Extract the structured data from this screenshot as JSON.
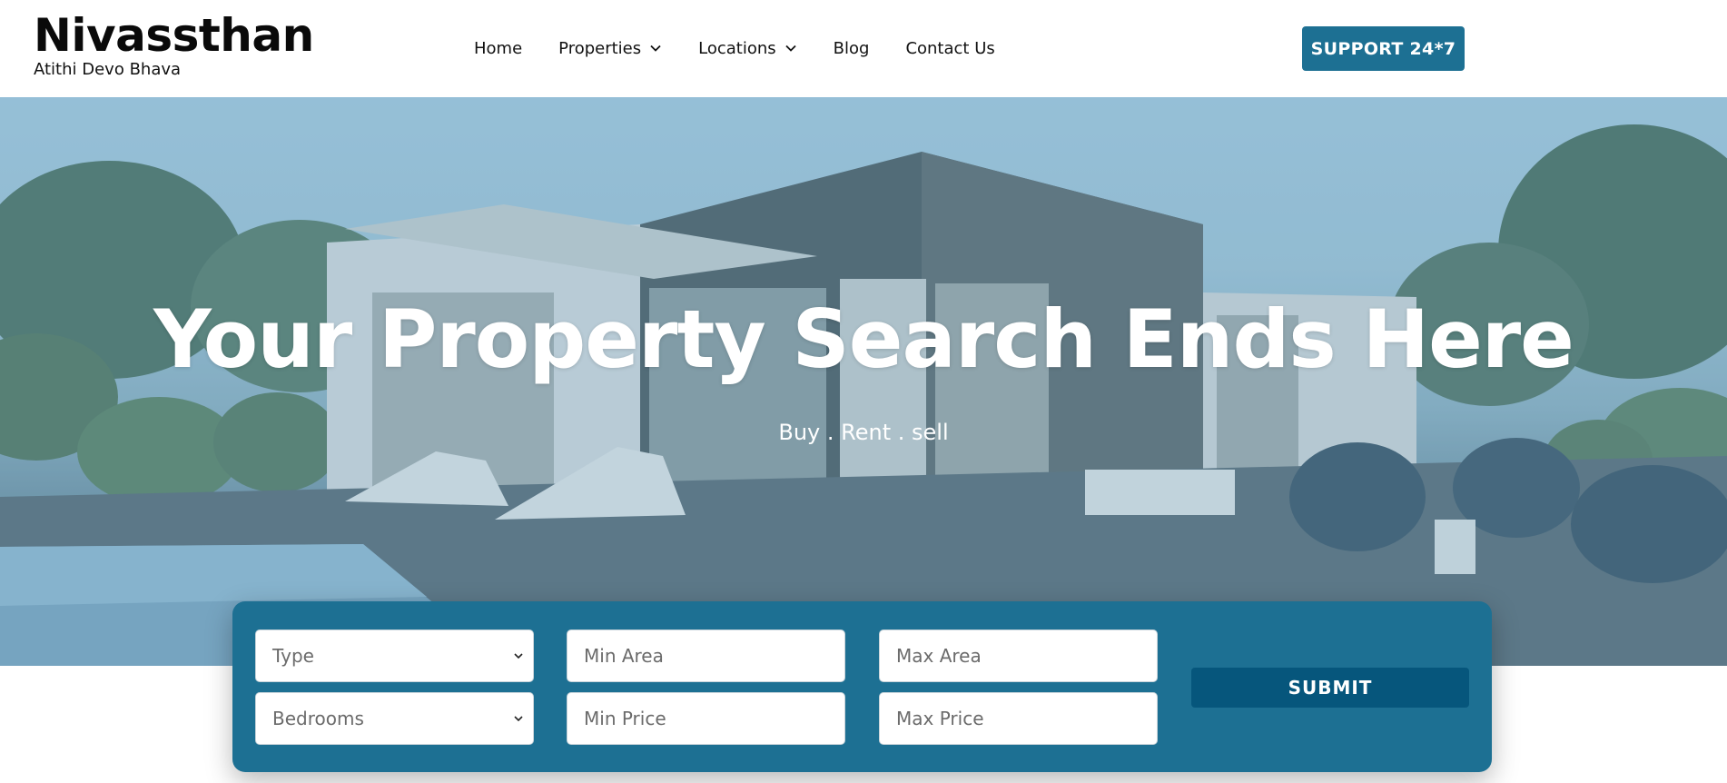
{
  "brand": {
    "title": "Nivassthan",
    "tagline": "Atithi Devo Bhava"
  },
  "nav": {
    "items": [
      {
        "label": "Home",
        "has_dropdown": false
      },
      {
        "label": "Properties",
        "has_dropdown": true
      },
      {
        "label": "Locations",
        "has_dropdown": true
      },
      {
        "label": "Blog",
        "has_dropdown": false
      },
      {
        "label": "Contact Us",
        "has_dropdown": false
      }
    ]
  },
  "support_button": {
    "label": "SUPPORT 24*7"
  },
  "hero": {
    "title": "Your Property Search Ends Here",
    "subtitle": "Buy . Rent . sell"
  },
  "search": {
    "type_select": {
      "value": "Type"
    },
    "bedrooms_select": {
      "value": "Bedrooms"
    },
    "min_area": {
      "placeholder": "Min Area"
    },
    "max_area": {
      "placeholder": "Max Area"
    },
    "min_price": {
      "placeholder": "Min Price"
    },
    "max_price": {
      "placeholder": "Max Price"
    },
    "submit_label": "SUBMIT"
  },
  "colors": {
    "accent": "#1d7093",
    "submit": "#06567c",
    "text": "#111111"
  }
}
